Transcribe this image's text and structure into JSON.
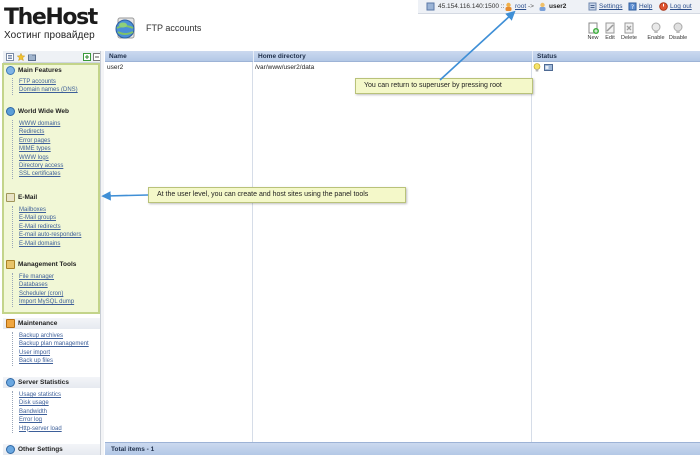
{
  "logo": {
    "main": "TheHost",
    "sub": "Хостинг провайдер"
  },
  "page": {
    "title": "FTP accounts"
  },
  "topbar": {
    "ip": "45.154.116.140:1500 ::",
    "root_link": "root",
    "arrow": "->",
    "current_user": "user2",
    "settings": "Settings",
    "help": "Help",
    "logout": "Log out"
  },
  "toolbar": {
    "new": "New",
    "edit": "Edit",
    "delete": "Delete",
    "enable": "Enable",
    "disable": "Disable"
  },
  "sidebar": {
    "sections": [
      {
        "title": "Main Features",
        "items": [
          "FTP accounts",
          "Domain names (DNS)"
        ]
      },
      {
        "title": "World Wide Web",
        "items": [
          "WWW domains",
          "Redirects",
          "Error pages",
          "MIME types",
          "WWW logs",
          "Directory access",
          "SSL certificates"
        ]
      },
      {
        "title": "E-Mail",
        "items": [
          "Mailboxes",
          "E-Mail groups",
          "E-Mail redirects",
          "E-mail auto-responders",
          "E-Mail domains"
        ]
      },
      {
        "title": "Management Tools",
        "items": [
          "File manager",
          "Databases",
          "Scheduler (cron)",
          "Import MySQL dump"
        ]
      },
      {
        "title": "Maintenance",
        "items": [
          "Backup archives",
          "Backup plan management",
          "User import",
          "Back up files"
        ]
      },
      {
        "title": "Server Statistics",
        "items": [
          "Usage statistics",
          "Disk usage",
          "Bandwidth",
          "Error log",
          "Http-server load"
        ]
      },
      {
        "title": "Other Settings",
        "items": []
      }
    ]
  },
  "table": {
    "columns": [
      "Name",
      "Home directory",
      "Status"
    ],
    "rows": [
      {
        "name": "user2",
        "home": "/var/www/user2/data"
      }
    ],
    "footer": "Total items - 1"
  },
  "callouts": {
    "superuser": "You can return to superuser by pressing root",
    "user_level": "At the user level, you can create and host sites using the panel tools"
  },
  "colors": {
    "accent": "#b3c8e6",
    "highlight": "#f1f7d6",
    "link": "#3d5f99",
    "arrow": "#3f8fd6"
  }
}
